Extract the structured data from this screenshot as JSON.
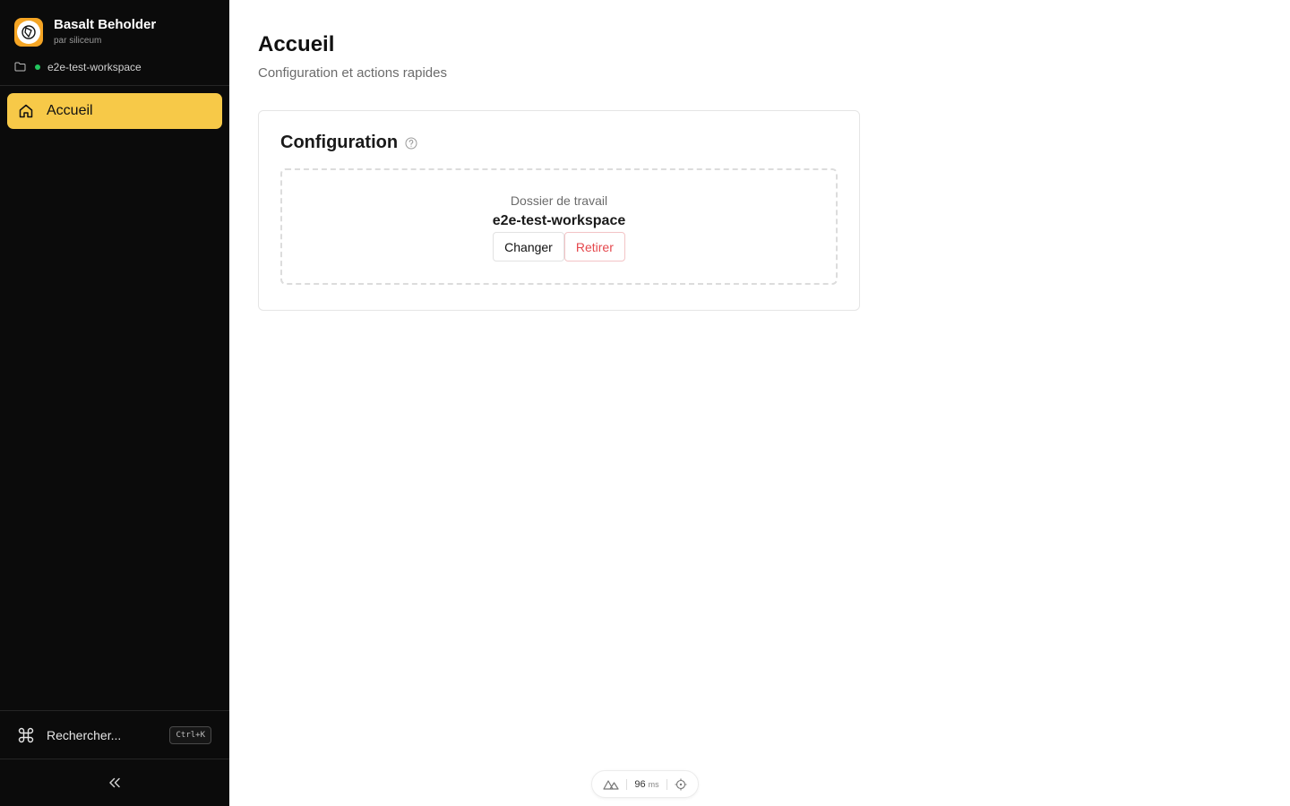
{
  "app": {
    "name": "Basalt Beholder",
    "byline": "par siliceum",
    "workspace_name": "e2e-test-workspace",
    "workspace_status_color": "#22c55e"
  },
  "sidebar": {
    "items": [
      {
        "label": "Accueil",
        "icon": "home-icon",
        "active": true
      }
    ],
    "search": {
      "label": "Rechercher...",
      "shortcut": "Ctrl+K",
      "icon": "command-icon"
    },
    "collapse_icon": "chevrons-left-icon"
  },
  "page": {
    "title": "Accueil",
    "subtitle": "Configuration et actions rapides"
  },
  "config_card": {
    "title": "Configuration",
    "help_icon": "help-circle-icon",
    "folder_label": "Dossier de travail",
    "folder_value": "e2e-test-workspace",
    "change_label": "Changer",
    "remove_label": "Retirer"
  },
  "perf": {
    "value": "96",
    "unit": "ms"
  },
  "colors": {
    "sidebar_bg": "#0b0b0b",
    "accent": "#f7c948",
    "logo_bg": "#f5a524",
    "danger": "#e5484d"
  }
}
